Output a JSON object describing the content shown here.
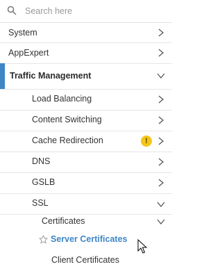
{
  "search": {
    "placeholder": "Search here",
    "icon": "search-icon"
  },
  "nav": {
    "system": "System",
    "appexpert": "AppExpert",
    "traffic_management": "Traffic Management",
    "load_balancing": "Load Balancing",
    "content_switching": "Content Switching",
    "cache_redirection": "Cache Redirection",
    "cache_warning": "!",
    "dns": "DNS",
    "gslb": "GSLB",
    "ssl": "SSL",
    "certificates": "Certificates",
    "server_certificates": "Server Certificates",
    "client_certificates": "Client Certificates"
  },
  "colors": {
    "accent": "#3f86c7",
    "warning": "#f5c518",
    "text": "#333333",
    "divider": "#e6e6e6"
  }
}
